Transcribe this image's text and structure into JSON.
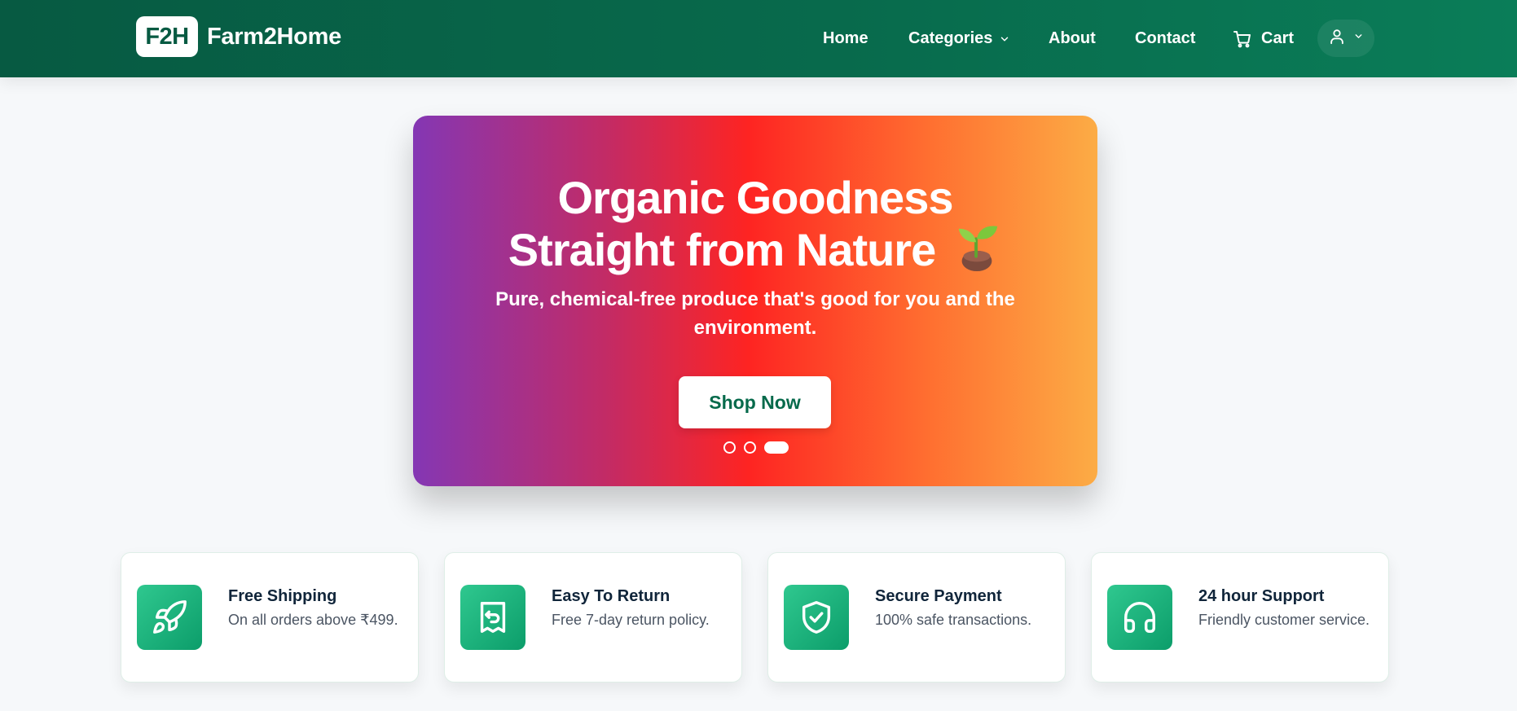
{
  "navbar": {
    "logo_text": "F2H",
    "brand_name": "Farm2Home",
    "links": {
      "home": "Home",
      "categories": "Categories",
      "about": "About",
      "contact": "Contact",
      "cart": "Cart"
    },
    "icons": {
      "categories": "chevron-down-icon",
      "cart": "shopping-cart-icon",
      "user": "user-icon",
      "user_menu": "chevron-down-icon"
    }
  },
  "hero": {
    "title_line1": "Organic Goodness",
    "title_line2": "Straight from Nature",
    "title_icon": "seedling-icon",
    "subtitle": "Pure, chemical-free produce that's good for you and the environment.",
    "cta_label": "Shop Now",
    "carousel": {
      "slides": 3,
      "active_slide": 3
    },
    "gradient_colors": [
      "#8437b4",
      "#c22b66",
      "#fe2422",
      "#ff6e30",
      "#fcac45"
    ]
  },
  "features": [
    {
      "title": "Free Shipping",
      "description": "On all orders above ₹499.",
      "icon": "rocket-icon"
    },
    {
      "title": "Easy To Return",
      "description": "Free 7-day return policy.",
      "icon": "return-receipt-icon"
    },
    {
      "title": "Secure Payment",
      "description": "100% safe transactions.",
      "icon": "shield-check-icon"
    },
    {
      "title": "24 hour Support",
      "description": "Friendly customer service.",
      "icon": "headphones-icon"
    }
  ],
  "colors": {
    "brand_primary": "#075a42",
    "brand_accent": "#0a7d58",
    "feature_icon_bg": "#16ad77",
    "page_bg": "#f6f8fa",
    "heading_text": "#10253a",
    "muted_text": "#4b5563"
  }
}
